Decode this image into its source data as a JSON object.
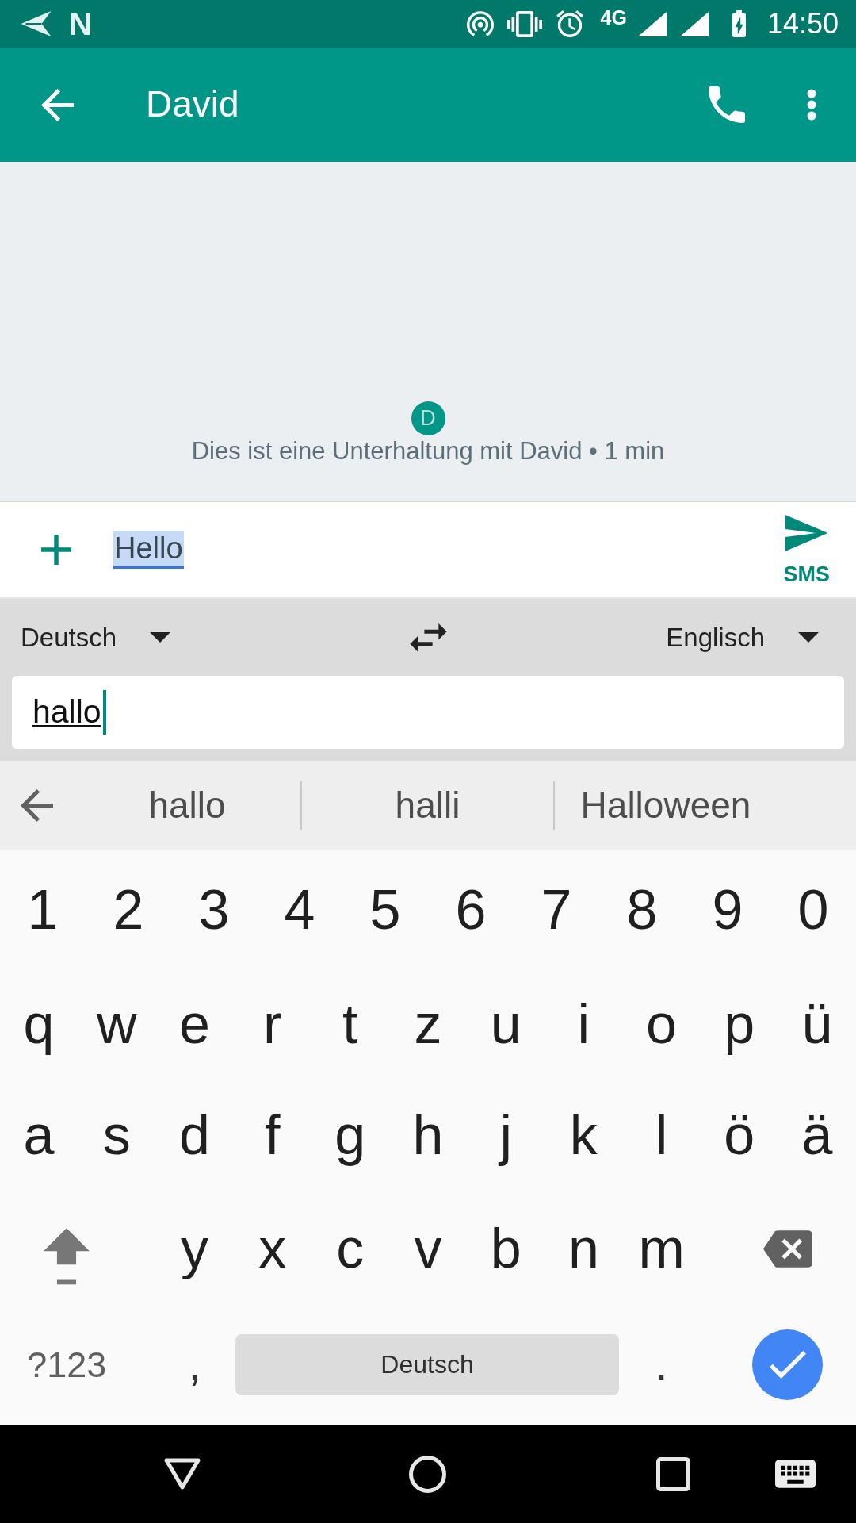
{
  "status_bar": {
    "notification_letter": "N",
    "network": "4G",
    "time": "14:50"
  },
  "app_bar": {
    "title": "David"
  },
  "conversation": {
    "avatar_initial": "D",
    "notice": "Dies ist eine Unterhaltung mit David • 1 min"
  },
  "compose": {
    "value": "Hello",
    "highlighted": true,
    "send_label": "SMS"
  },
  "translate": {
    "source_language": "Deutsch",
    "target_language": "Englisch",
    "input": {
      "value": "hallo",
      "underlined": true
    }
  },
  "suggestions": [
    "hallo",
    "halli",
    "Halloween"
  ],
  "keyboard": {
    "key_rows": [
      {
        "keys": [
          {
            "kind": "char",
            "label": "1"
          },
          {
            "kind": "char",
            "label": "2"
          },
          {
            "kind": "char",
            "label": "3"
          },
          {
            "kind": "char",
            "label": "4"
          },
          {
            "kind": "char",
            "label": "5"
          },
          {
            "kind": "char",
            "label": "6"
          },
          {
            "kind": "char",
            "label": "7"
          },
          {
            "kind": "char",
            "label": "8"
          },
          {
            "kind": "char",
            "label": "9"
          },
          {
            "kind": "char",
            "label": "0"
          }
        ]
      },
      {
        "keys": [
          {
            "kind": "char",
            "label": "q"
          },
          {
            "kind": "char",
            "label": "w"
          },
          {
            "kind": "char",
            "label": "e"
          },
          {
            "kind": "char",
            "label": "r"
          },
          {
            "kind": "char",
            "label": "t"
          },
          {
            "kind": "char",
            "label": "z"
          },
          {
            "kind": "char",
            "label": "u"
          },
          {
            "kind": "char",
            "label": "i"
          },
          {
            "kind": "char",
            "label": "o"
          },
          {
            "kind": "char",
            "label": "p"
          },
          {
            "kind": "char",
            "label": "ü"
          }
        ]
      },
      {
        "keys": [
          {
            "kind": "char",
            "label": "a"
          },
          {
            "kind": "char",
            "label": "s"
          },
          {
            "kind": "char",
            "label": "d"
          },
          {
            "kind": "char",
            "label": "f"
          },
          {
            "kind": "char",
            "label": "g"
          },
          {
            "kind": "char",
            "label": "h"
          },
          {
            "kind": "char",
            "label": "j"
          },
          {
            "kind": "char",
            "label": "k"
          },
          {
            "kind": "char",
            "label": "l"
          },
          {
            "kind": "char",
            "label": "ö"
          },
          {
            "kind": "char",
            "label": "ä"
          }
        ]
      },
      {
        "keys": [
          {
            "kind": "shift"
          },
          {
            "kind": "char",
            "label": "y"
          },
          {
            "kind": "char",
            "label": "x"
          },
          {
            "kind": "char",
            "label": "c"
          },
          {
            "kind": "char",
            "label": "v"
          },
          {
            "kind": "char",
            "label": "b"
          },
          {
            "kind": "char",
            "label": "n"
          },
          {
            "kind": "char",
            "label": "m"
          },
          {
            "kind": "backspace"
          }
        ]
      },
      {
        "keys": [
          {
            "kind": "symbols",
            "label": "?123"
          },
          {
            "kind": "punct",
            "label": ","
          },
          {
            "kind": "space",
            "label": "Deutsch"
          },
          {
            "kind": "punct",
            "label": "."
          },
          {
            "kind": "enter"
          }
        ]
      }
    ]
  }
}
